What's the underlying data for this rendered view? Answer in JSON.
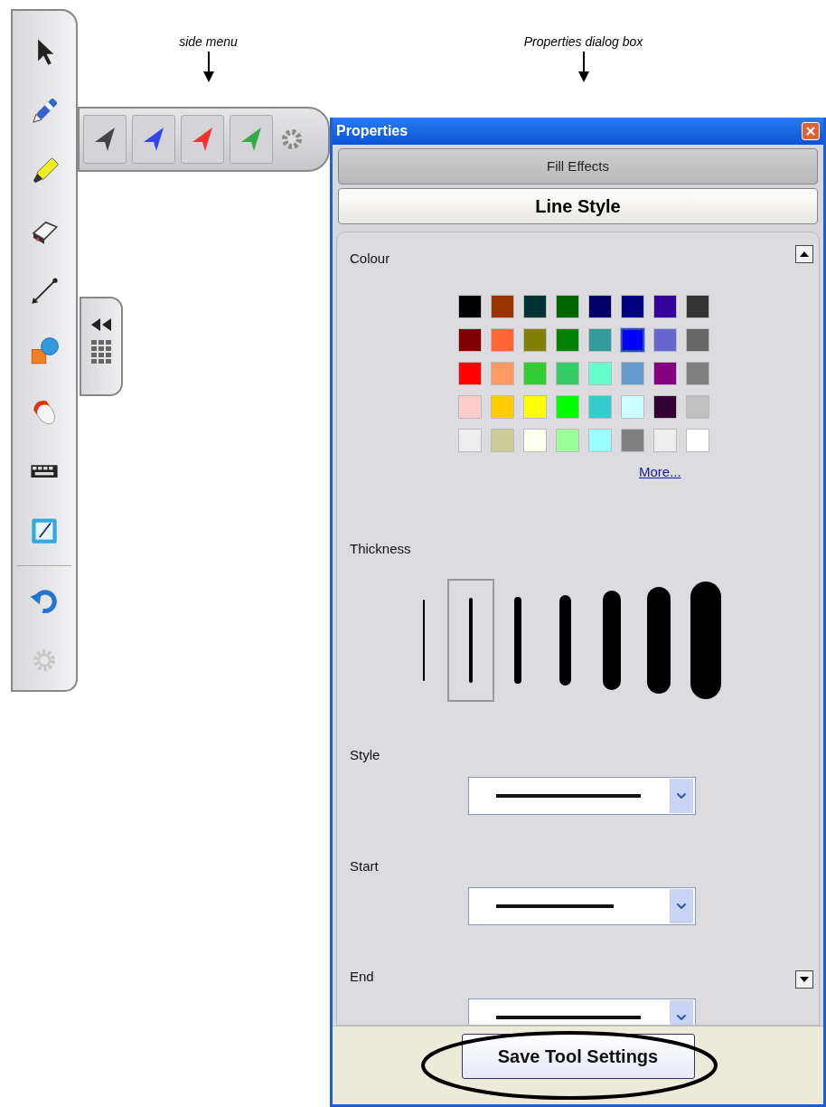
{
  "annotations": [
    {
      "text": "side menu"
    },
    {
      "text": "Properties dialog box"
    }
  ],
  "side_menu": {
    "pens": [
      {
        "color": "#444444"
      },
      {
        "color": "#3344ee"
      },
      {
        "color": "#ee3333"
      },
      {
        "color": "#33aa44"
      }
    ]
  },
  "dialog": {
    "title": "Properties",
    "tabs": [
      {
        "label": "Fill Effects",
        "selected": false
      },
      {
        "label": "Line Style",
        "selected": true
      }
    ],
    "colour": {
      "label": "Colour",
      "more_link": "More...",
      "swatches": [
        [
          {
            "color": "#000000",
            "selected": false
          },
          {
            "color": "#993300",
            "selected": false
          },
          {
            "color": "#003333",
            "selected": false
          },
          {
            "color": "#006600",
            "selected": false
          },
          {
            "color": "#000066",
            "selected": false
          },
          {
            "color": "#000080",
            "selected": false
          },
          {
            "color": "#330099",
            "selected": false
          },
          {
            "color": "#333333",
            "selected": false
          }
        ],
        [
          {
            "color": "#800000",
            "selected": false
          },
          {
            "color": "#ff6633",
            "selected": false
          },
          {
            "color": "#808000",
            "selected": false
          },
          {
            "color": "#008000",
            "selected": false
          },
          {
            "color": "#339999",
            "selected": false
          },
          {
            "color": "#0000ff",
            "selected": true
          },
          {
            "color": "#6666cc",
            "selected": false
          },
          {
            "color": "#666666",
            "selected": false
          }
        ],
        [
          {
            "color": "#ff0000",
            "selected": false
          },
          {
            "color": "#ff9966",
            "selected": false
          },
          {
            "color": "#33cc33",
            "selected": false
          },
          {
            "color": "#33cc66",
            "selected": false
          },
          {
            "color": "#66ffcc",
            "selected": false
          },
          {
            "color": "#6699cc",
            "selected": false
          },
          {
            "color": "#800080",
            "selected": false
          },
          {
            "color": "#808080",
            "selected": false
          }
        ],
        [
          {
            "color": "#ffcccc",
            "selected": false
          },
          {
            "color": "#ffcc00",
            "selected": false
          },
          {
            "color": "#ffff00",
            "selected": false
          },
          {
            "color": "#00ff00",
            "selected": false
          },
          {
            "color": "#33cccc",
            "selected": false
          },
          {
            "color": "#ccffff",
            "selected": false
          },
          {
            "color": "#330033",
            "selected": false
          },
          {
            "color": "#c0c0c0",
            "selected": false
          }
        ],
        [
          {
            "color": "#eeeeee",
            "selected": false
          },
          {
            "color": "#cccc99",
            "selected": false
          },
          {
            "color": "#fffff0",
            "selected": false
          },
          {
            "color": "#99ff99",
            "selected": false
          },
          {
            "color": "#99ffff",
            "selected": false
          },
          {
            "color": "#808080",
            "selected": false
          },
          {
            "color": "#eeeeee",
            "selected": false
          },
          {
            "color": "#ffffff",
            "selected": false
          }
        ]
      ]
    },
    "thickness": {
      "label": "Thickness",
      "options": [
        {
          "selected": false
        },
        {
          "selected": true
        },
        {
          "selected": false
        },
        {
          "selected": false
        },
        {
          "selected": false
        },
        {
          "selected": false
        },
        {
          "selected": false
        }
      ]
    },
    "dropdowns": [
      {
        "label": "Style"
      },
      {
        "label": "Start"
      },
      {
        "label": "End"
      }
    ],
    "save_button": "Save Tool Settings"
  }
}
